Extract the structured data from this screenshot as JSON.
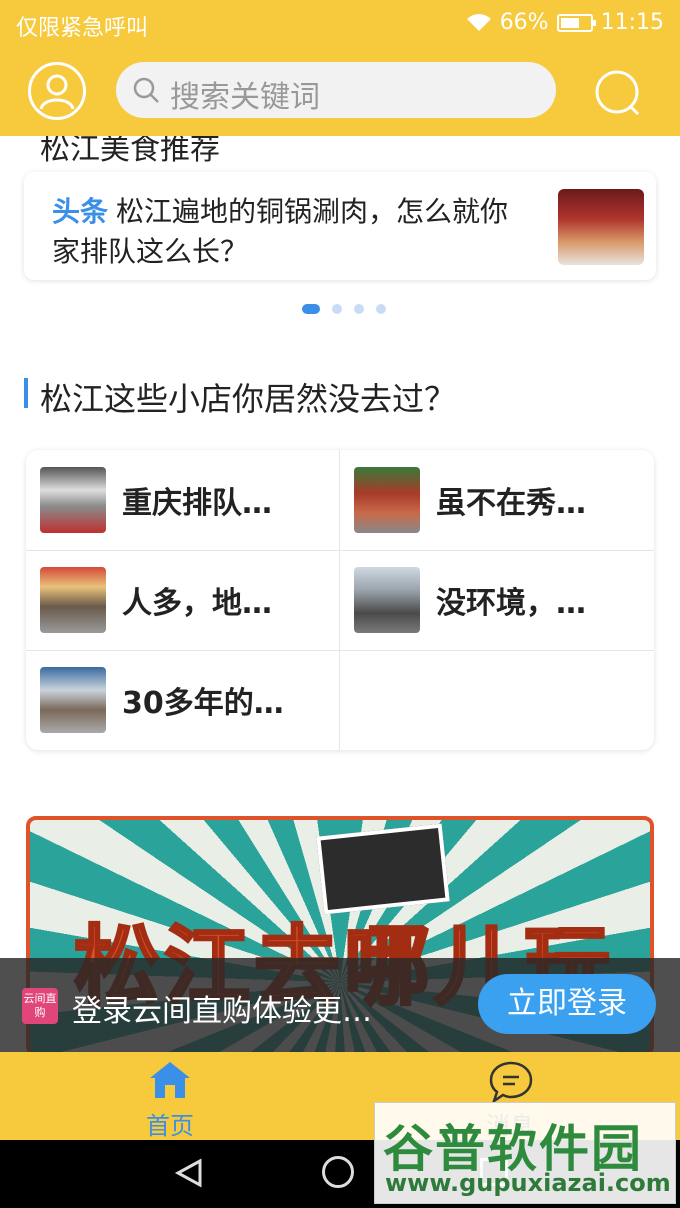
{
  "status_bar": {
    "carrier_text": "仅限紧急呼叫",
    "battery": "66%",
    "battery_level": 0.66,
    "time": "11:15"
  },
  "header": {
    "search_placeholder": "搜索关键词"
  },
  "headline": {
    "section_title_partial": "松江美食推荐",
    "tag": "头条",
    "text": "松江遍地的铜锅涮肉，怎么就你家排队这么长？",
    "active_page": 1,
    "page_count": 4
  },
  "shops_section": {
    "title": "松江这些小店你居然没去过？",
    "items": [
      {
        "name": "重庆排队…"
      },
      {
        "name": "虽不在秀…"
      },
      {
        "name": "人多，地…"
      },
      {
        "name": "没环境，…"
      },
      {
        "name": "30多年的…"
      }
    ]
  },
  "banner": {
    "title": "松江去哪儿玩"
  },
  "login_prompt": {
    "app_logo_text": "云间直购",
    "text": "登录云间直购体验更…",
    "button": "立即登录"
  },
  "tabbar": {
    "tabs": [
      {
        "label": "首页",
        "icon": "home-icon",
        "active": true
      },
      {
        "label": "消息",
        "icon": "chat-icon",
        "active": false
      }
    ]
  },
  "watermark": {
    "title": "谷普软件园",
    "url": "www.gupuxiazai.com"
  },
  "colors": {
    "brand_yellow": "#f7c93c",
    "accent_blue": "#3a8fe8"
  }
}
